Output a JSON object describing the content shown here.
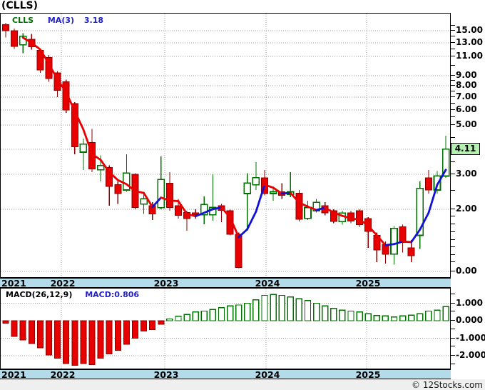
{
  "title": "(CLLS)",
  "legend": {
    "symbol": "CLLS",
    "ma_label": "MA(3)",
    "ma_value": "3.18"
  },
  "price_badge": "4.11",
  "macd_header": {
    "label": "MACD(26,12,9)",
    "value": "MACD:0.806"
  },
  "watermark": "© 12Stocks.com",
  "colors": {
    "up_green": "#007000",
    "down_red": "#e80000",
    "down_edge": "#8b0000",
    "ma_rising_blue": "#1111d6",
    "ma_falling_red": "#e80000",
    "legend_symbol_green": "#007000",
    "legend_ma_blue": "#2222cc",
    "band_background": "#b4dbe9",
    "strip_background": "#efefef",
    "badge_background": "#b4f1b0",
    "gridline_gray": "#999999"
  },
  "x_axis": {
    "years": [
      {
        "label": "2021",
        "x": 2,
        "align": "left",
        "grid_x": null
      },
      {
        "label": "2022",
        "x": 88,
        "align": "center",
        "grid_x": 85
      },
      {
        "label": "2023",
        "x": 233,
        "align": "center",
        "grid_x": 230
      },
      {
        "label": "2024",
        "x": 375,
        "align": "center",
        "grid_x": 372
      },
      {
        "label": "2025",
        "x": 516,
        "align": "center",
        "grid_x": 513
      }
    ]
  },
  "price_axis": {
    "labels": [
      {
        "text": "15.00",
        "value": 15
      },
      {
        "text": "13.00",
        "value": 13
      },
      {
        "text": "11.00",
        "value": 11
      },
      {
        "text": "9.00",
        "value": 9
      },
      {
        "text": "8.00",
        "value": 8
      },
      {
        "text": "7.00",
        "value": 7
      },
      {
        "text": "6.00",
        "value": 6
      },
      {
        "text": "5.00",
        "value": 5
      },
      {
        "text": "3.00",
        "value": 3
      },
      {
        "text": "2.00",
        "value": 2
      },
      {
        "text": "0.00",
        "value": 0
      }
    ]
  },
  "macd_axis": {
    "labels": [
      {
        "text": "1.000",
        "value": 1
      },
      {
        "text": "0.000",
        "value": 0
      },
      {
        "text": "-1.000",
        "value": -1
      },
      {
        "text": "-2.000",
        "value": -2
      }
    ]
  },
  "chart_data": [
    {
      "type": "candlestick",
      "symbol": "CLLS",
      "ma_period": 3,
      "ma_last_value": 3.18,
      "last_price": 4.11,
      "x_tick_labels": [
        "2021",
        "2022",
        "2023",
        "2024",
        "2025"
      ],
      "y_tick_values": [
        15,
        13,
        11,
        9,
        8,
        7,
        6,
        5,
        3,
        2,
        0
      ],
      "ylim": [
        0,
        17
      ],
      "scale_note": "log-like above 2, linear below 2",
      "candles_ohlc": [
        [
          16.2,
          16.6,
          13.9,
          15.0
        ],
        [
          15.0,
          15.4,
          12.1,
          12.5
        ],
        [
          12.7,
          14.6,
          11.5,
          14.1
        ],
        [
          13.6,
          14.5,
          12.0,
          12.4
        ],
        [
          11.9,
          12.1,
          9.3,
          9.6
        ],
        [
          10.9,
          11.2,
          8.4,
          8.7
        ],
        [
          9.3,
          9.5,
          7.0,
          7.6
        ],
        [
          8.4,
          8.6,
          5.8,
          6.0
        ],
        [
          6.5,
          6.6,
          3.9,
          4.2
        ],
        [
          4.0,
          4.5,
          3.2,
          4.3
        ],
        [
          4.35,
          4.85,
          3.1,
          3.25
        ],
        [
          3.2,
          3.85,
          2.8,
          3.4
        ],
        [
          3.3,
          3.4,
          2.1,
          2.65
        ],
        [
          2.7,
          2.8,
          2.15,
          2.45
        ],
        [
          2.55,
          3.9,
          2.5,
          3.05
        ],
        [
          3.0,
          3.05,
          2.0,
          2.05
        ],
        [
          2.15,
          2.5,
          1.85,
          2.3
        ],
        [
          2.1,
          2.2,
          1.65,
          1.85
        ],
        [
          2.05,
          3.8,
          2.0,
          2.85
        ],
        [
          2.75,
          3.1,
          1.95,
          2.05
        ],
        [
          2.1,
          2.3,
          1.7,
          1.8
        ],
        [
          1.9,
          1.95,
          1.3,
          1.7
        ],
        [
          1.88,
          2.0,
          1.7,
          1.82
        ],
        [
          1.82,
          2.37,
          1.51,
          2.14
        ],
        [
          1.82,
          3.0,
          1.63,
          2.05
        ],
        [
          2.1,
          2.15,
          1.58,
          1.97
        ],
        [
          1.95,
          2.0,
          1.15,
          1.19
        ],
        [
          1.19,
          1.25,
          0.1,
          0.12
        ],
        [
          2.45,
          3.05,
          1.3,
          2.75
        ],
        [
          2.7,
          3.55,
          2.55,
          2.9
        ],
        [
          2.9,
          3.2,
          2.4,
          2.45
        ],
        [
          2.45,
          2.65,
          2.25,
          2.5
        ],
        [
          2.5,
          2.75,
          2.3,
          2.4
        ],
        [
          2.42,
          3.1,
          2.35,
          2.5
        ],
        [
          2.46,
          2.55,
          1.6,
          1.68
        ],
        [
          1.7,
          2.25,
          1.65,
          2.05
        ],
        [
          1.95,
          2.3,
          1.9,
          2.2
        ],
        [
          2.1,
          2.2,
          1.8,
          1.88
        ],
        [
          1.95,
          2.0,
          1.55,
          1.6
        ],
        [
          1.6,
          1.95,
          1.5,
          1.88
        ],
        [
          1.88,
          1.95,
          1.55,
          1.62
        ],
        [
          1.95,
          2.0,
          1.42,
          1.5
        ],
        [
          1.7,
          1.75,
          0.75,
          1.28
        ],
        [
          1.15,
          1.25,
          0.3,
          0.68
        ],
        [
          0.85,
          0.95,
          0.25,
          0.55
        ],
        [
          0.55,
          1.45,
          0.22,
          1.38
        ],
        [
          1.43,
          1.5,
          0.6,
          0.92
        ],
        [
          0.75,
          1.0,
          0.3,
          0.5
        ],
        [
          1.15,
          2.8,
          0.72,
          2.6
        ],
        [
          2.9,
          3.2,
          2.45,
          2.55
        ],
        [
          2.55,
          3.15,
          2.45,
          2.95
        ],
        [
          2.95,
          4.6,
          2.9,
          4.11
        ]
      ]
    },
    {
      "type": "bar",
      "name": "MACD(26,12,9)",
      "last_value": 0.806,
      "y_tick_values": [
        1.0,
        0.0,
        -1.0,
        -2.0
      ],
      "ylim": [
        -2.6,
        1.6
      ],
      "values": [
        -0.15,
        -0.9,
        -1.1,
        -1.3,
        -1.55,
        -1.95,
        -2.15,
        -2.45,
        -2.55,
        -2.45,
        -2.5,
        -2.15,
        -1.9,
        -1.7,
        -1.35,
        -1.0,
        -0.6,
        -0.5,
        -0.2,
        0.1,
        0.25,
        0.35,
        0.5,
        0.55,
        0.65,
        0.75,
        0.85,
        0.9,
        1.0,
        1.2,
        1.45,
        1.5,
        1.45,
        1.35,
        1.25,
        1.15,
        1.0,
        0.85,
        0.7,
        0.6,
        0.55,
        0.5,
        0.4,
        0.3,
        0.28,
        0.22,
        0.28,
        0.32,
        0.4,
        0.55,
        0.6,
        0.806
      ]
    }
  ]
}
